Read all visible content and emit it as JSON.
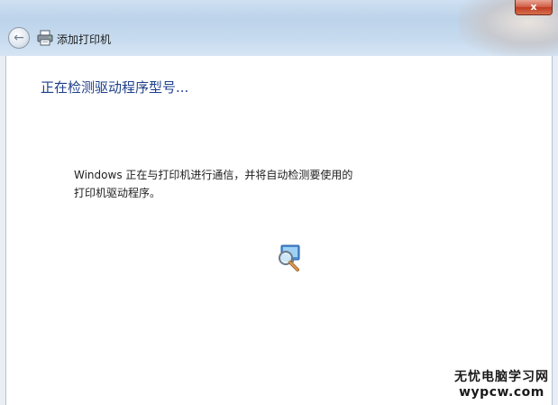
{
  "window": {
    "title": "添加打印机",
    "close_label": "x"
  },
  "icons": {
    "back": "back-arrow-icon",
    "printer": "printer-icon",
    "search": "driver-search-icon"
  },
  "main": {
    "heading": "正在检测驱动程序型号...",
    "description_line1": "Windows 正在与打印机进行通信，并将自动检测要使用的",
    "description_line2": "打印机驱动程序。"
  },
  "watermark": {
    "site_name": "无忧电脑学习网",
    "url": "wypcw.com"
  },
  "colors": {
    "heading": "#1e3f8a",
    "chrome": "#c7dbef",
    "close": "#c13b22"
  }
}
